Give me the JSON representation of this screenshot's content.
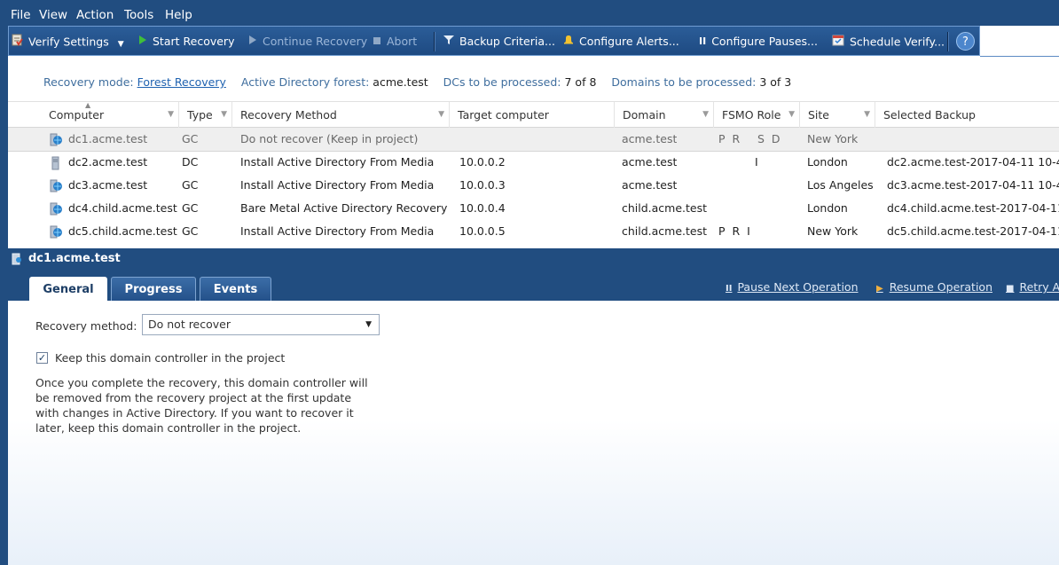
{
  "menu": [
    "File",
    "View",
    "Action",
    "Tools",
    "Help"
  ],
  "toolbar": {
    "verify_settings": "Verify Settings",
    "start_recovery": "Start Recovery",
    "continue_recovery": "Continue Recovery",
    "abort": "Abort",
    "backup_criteria": "Backup Criteria...",
    "configure_alerts": "Configure Alerts...",
    "configure_pauses": "Configure Pauses...",
    "schedule_verify": "Schedule Verify...",
    "help_icon": "help-icon"
  },
  "summary": {
    "recovery_mode_label": "Recovery mode:",
    "recovery_mode_value": "Forest Recovery",
    "forest_label": "Active Directory forest:",
    "forest_value": "acme.test",
    "dcs_label": "DCs to be processed:",
    "dcs_value": "7 of 8",
    "domains_label": "Domains to be processed:",
    "domains_value": "3 of 3"
  },
  "grid": {
    "columns": [
      "Computer",
      "Type",
      "Recovery Method",
      "Target computer",
      "Domain",
      "FSMO Role",
      "Site",
      "Selected Backup"
    ],
    "rows": [
      {
        "computer": "dc1.acme.test",
        "type": "GC",
        "method": "Do not recover (Keep in project)",
        "target": "",
        "domain": "acme.test",
        "fsmo": "P  R     S  D",
        "site": "New York",
        "backup": ""
      },
      {
        "computer": "dc2.acme.test",
        "type": "DC",
        "method": "Install Active Directory From Media",
        "target": "10.0.0.2",
        "domain": "acme.test",
        "fsmo": "I",
        "site": "London",
        "backup": "dc2.acme.test-2017-04-11 10-4"
      },
      {
        "computer": "dc3.acme.test",
        "type": "GC",
        "method": "Install Active Directory From Media",
        "target": "10.0.0.3",
        "domain": "acme.test",
        "fsmo": "",
        "site": "Los Angeles",
        "backup": "dc3.acme.test-2017-04-11 10-4"
      },
      {
        "computer": "dc4.child.acme.test",
        "type": "GC",
        "method": "Bare Metal Active Directory Recovery",
        "target": "10.0.0.4",
        "domain": "child.acme.test",
        "fsmo": "",
        "site": "London",
        "backup": "dc4.child.acme.test-2017-04-11"
      },
      {
        "computer": "dc5.child.acme.test",
        "type": "GC",
        "method": "Install Active Directory From Media",
        "target": "10.0.0.5",
        "domain": "child.acme.test",
        "fsmo": "P  R  I",
        "site": "New York",
        "backup": "dc5.child.acme.test-2017-04-11"
      }
    ]
  },
  "details": {
    "title": "dc1.acme.test",
    "tabs": [
      "General",
      "Progress",
      "Events"
    ],
    "actions": {
      "pause": "Pause Next Operation",
      "resume": "Resume Operation",
      "retry": "Retry A"
    },
    "recovery_method_label": "Recovery method:",
    "recovery_method_value": "Do not recover",
    "keep_checkbox_label": "Keep this domain controller in the project",
    "keep_checked": true,
    "description": "Once you complete the recovery, this domain controller will be removed from the recovery project at the first update with changes in Active Directory. If you want to recover it later, keep this domain controller in the project."
  },
  "colors": {
    "chrome_blue": "#214d80",
    "link_blue": "#1f62b0",
    "selected_row": "#efefef"
  }
}
